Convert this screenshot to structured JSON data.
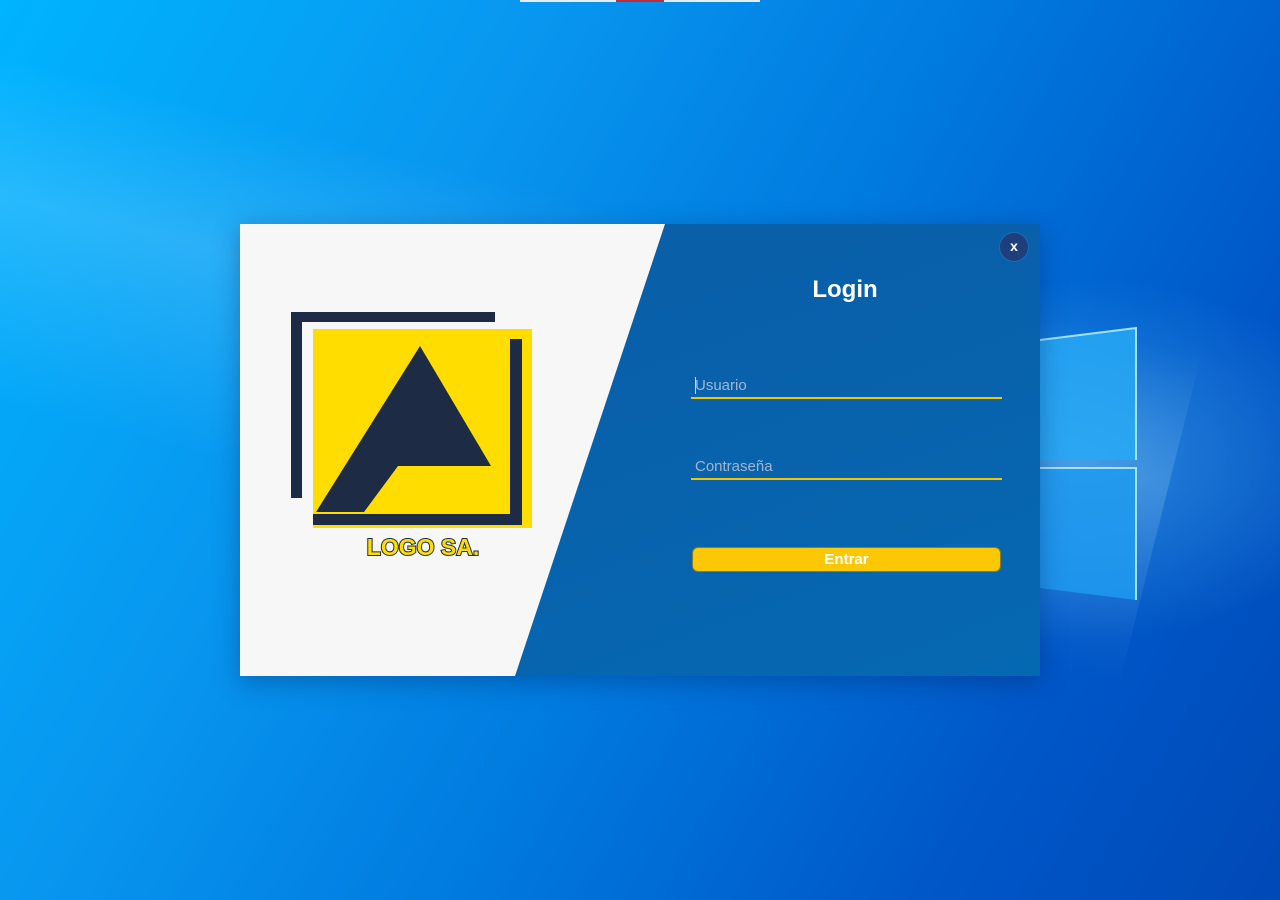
{
  "login": {
    "title": "Login",
    "close_label": "x",
    "username": {
      "placeholder": "Usuario",
      "value": ""
    },
    "password": {
      "placeholder": "Contraseña",
      "value": ""
    },
    "submit_label": "Entrar"
  },
  "logo": {
    "text": "LOGO SA.",
    "icon": "company-logo-icon"
  },
  "colors": {
    "accent": "#fcc806",
    "panel_blue": "#0861ab",
    "logo_navy": "#1e2b45",
    "logo_yellow": "#ffdd00"
  }
}
